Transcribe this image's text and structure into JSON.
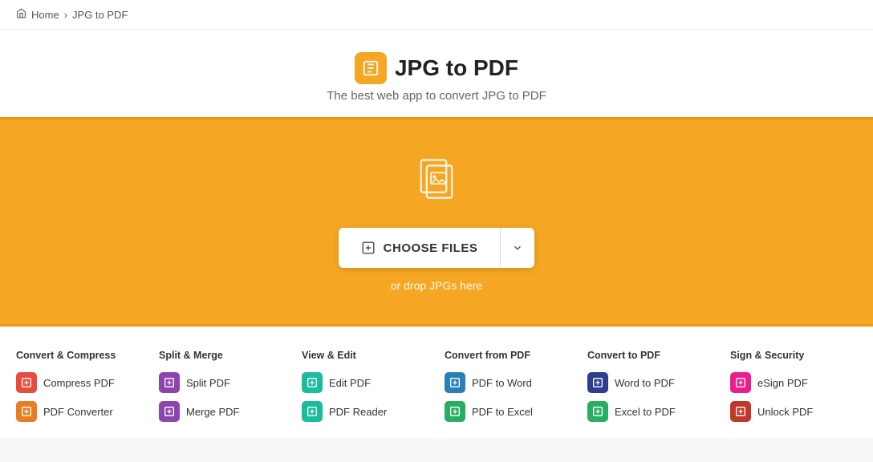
{
  "breadcrumb": {
    "home_label": "Home",
    "current_label": "JPG to PDF",
    "separator": "›"
  },
  "header": {
    "title": "JPG to PDF",
    "subtitle": "The best web app to convert JPG to PDF"
  },
  "dropzone": {
    "choose_files_label": "CHOOSE FILES",
    "drop_hint": "or drop JPGs here"
  },
  "footer": {
    "columns": [
      {
        "heading": "Convert & Compress",
        "items": [
          {
            "label": "Compress PDF",
            "icon_color": "ic-red"
          },
          {
            "label": "PDF Converter",
            "icon_color": "ic-orange"
          }
        ]
      },
      {
        "heading": "Split & Merge",
        "items": [
          {
            "label": "Split PDF",
            "icon_color": "ic-purple"
          },
          {
            "label": "Merge PDF",
            "icon_color": "ic-purple"
          }
        ]
      },
      {
        "heading": "View & Edit",
        "items": [
          {
            "label": "Edit PDF",
            "icon_color": "ic-teal"
          },
          {
            "label": "PDF Reader",
            "icon_color": "ic-teal"
          }
        ]
      },
      {
        "heading": "Convert from PDF",
        "items": [
          {
            "label": "PDF to Word",
            "icon_color": "ic-blue"
          },
          {
            "label": "PDF to Excel",
            "icon_color": "ic-green"
          }
        ]
      },
      {
        "heading": "Convert to PDF",
        "items": [
          {
            "label": "Word to PDF",
            "icon_color": "ic-dark-blue"
          },
          {
            "label": "Excel to PDF",
            "icon_color": "ic-green"
          }
        ]
      },
      {
        "heading": "Sign & Security",
        "items": [
          {
            "label": "eSign PDF",
            "icon_color": "ic-pink"
          },
          {
            "label": "Unlock PDF",
            "icon_color": "ic-dark-red"
          }
        ]
      }
    ]
  }
}
